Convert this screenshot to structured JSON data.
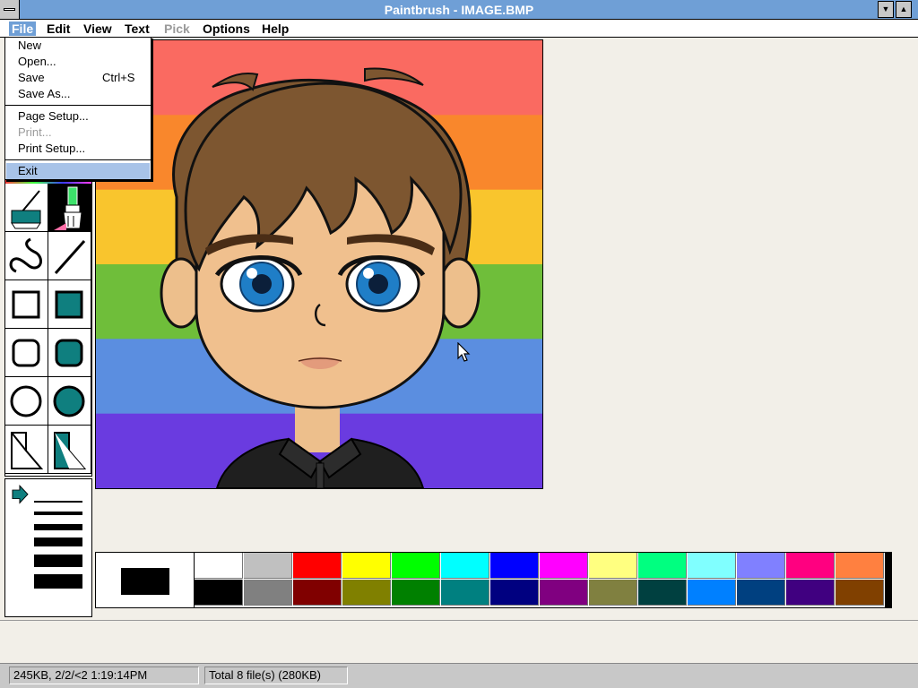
{
  "window": {
    "title": "Paintbrush - IMAGE.BMP",
    "minimize_glyph": "▼",
    "maximize_glyph": "▲"
  },
  "menubar": {
    "items": [
      {
        "label": "File",
        "state": "open"
      },
      {
        "label": "Edit",
        "state": "normal"
      },
      {
        "label": "View",
        "state": "normal"
      },
      {
        "label": "Text",
        "state": "normal"
      },
      {
        "label": "Pick",
        "state": "disabled"
      },
      {
        "label": "Options",
        "state": "normal"
      },
      {
        "label": "Help",
        "state": "normal"
      }
    ]
  },
  "file_menu": {
    "items": [
      {
        "label": "New",
        "enabled": true
      },
      {
        "label": "Open...",
        "enabled": true
      },
      {
        "label": "Save",
        "shortcut": "Ctrl+S",
        "enabled": true
      },
      {
        "label": "Save As...",
        "enabled": true
      },
      {
        "label": "Page Setup...",
        "enabled": true
      },
      {
        "label": "Print...",
        "enabled": false
      },
      {
        "label": "Print Setup...",
        "enabled": true
      },
      {
        "label": "Exit",
        "enabled": true,
        "highlighted": true
      }
    ]
  },
  "toolbox": {
    "tools": [
      {
        "name": "color-eraser",
        "icon": "color-eraser-icon",
        "selected": false
      },
      {
        "name": "brush",
        "icon": "brush-icon",
        "selected": true
      },
      {
        "name": "curve",
        "icon": "curve-icon",
        "selected": false
      },
      {
        "name": "line",
        "icon": "line-icon",
        "selected": false
      },
      {
        "name": "box",
        "icon": "box-icon",
        "selected": false
      },
      {
        "name": "filled-box",
        "icon": "filled-box-icon",
        "selected": false
      },
      {
        "name": "rounded-box",
        "icon": "rounded-box-icon",
        "selected": false
      },
      {
        "name": "filled-rounded-box",
        "icon": "filled-rounded-box-icon",
        "selected": false
      },
      {
        "name": "circle",
        "icon": "circle-icon",
        "selected": false
      },
      {
        "name": "filled-circle",
        "icon": "filled-circle-icon",
        "selected": false
      },
      {
        "name": "polygon",
        "icon": "polygon-icon",
        "selected": false
      },
      {
        "name": "filled-polygon",
        "icon": "filled-polygon-icon",
        "selected": false
      }
    ],
    "accent_color": "#0f7f7f"
  },
  "line_widths": {
    "selected_index": 0,
    "count": 6
  },
  "palette": {
    "foreground": "#000000",
    "background": "#ffffff",
    "top_row": [
      "#ffffff",
      "#c0c0c0",
      "#ff0000",
      "#ffff00",
      "#00ff00",
      "#00ffff",
      "#0000ff",
      "#ff00ff",
      "#ffff80",
      "#00ff80",
      "#80ffff",
      "#8080ff",
      "#ff0080",
      "#ff8040"
    ],
    "bottom_row": [
      "#000000",
      "#808080",
      "#800000",
      "#808000",
      "#008000",
      "#008080",
      "#000080",
      "#800080",
      "#808040",
      "#004040",
      "#0080ff",
      "#004080",
      "#400080",
      "#804000"
    ]
  },
  "canvas": {
    "stripes": [
      "#fa6a61",
      "#f9872c",
      "#f9c52d",
      "#6fbe3a",
      "#5b8ee0",
      "#6a3be0"
    ]
  },
  "status": {
    "left": "245KB, 2/2/<2 1:19:14PM",
    "right": "Total 8 file(s) (280KB)"
  }
}
